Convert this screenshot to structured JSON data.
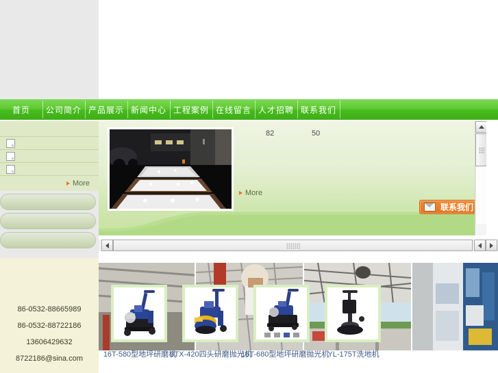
{
  "site": {
    "header": {
      "logo_placeholder": "",
      "banner_placeholder": ""
    },
    "nav": {
      "items": [
        {
          "label": "首页",
          "name": "home"
        },
        {
          "label": "公司简介",
          "name": "about"
        },
        {
          "label": "产品展示",
          "name": "products"
        },
        {
          "label": "新闻中心",
          "name": "news"
        },
        {
          "label": "工程案例",
          "name": "cases"
        },
        {
          "label": "在线留言",
          "name": "message"
        },
        {
          "label": "人才招聘",
          "name": "jobs"
        },
        {
          "label": "联系我们",
          "name": "contact"
        }
      ]
    },
    "sidebar": {
      "rows": [
        {
          "icon": "broken-image-icon",
          "label": ""
        },
        {
          "icon": "broken-image-icon",
          "label": ""
        },
        {
          "icon": "broken-image-icon",
          "label": ""
        }
      ],
      "more_label": "More",
      "buttons": [
        {
          "label": ""
        },
        {
          "label": ""
        },
        {
          "label": ""
        }
      ],
      "contact_lines": [
        "86-0532-88665989",
        "86-0532-88722186",
        "13606429632",
        "8722186@sina.com"
      ]
    },
    "showcase": {
      "hero_image_alt": "polished-stone-floor-showroom",
      "stat_a": "82",
      "stat_b": "50",
      "more_label": "More",
      "contact_button": {
        "label": "联系我们",
        "icon": "envelope-icon",
        "bg_color": "#e4741d"
      }
    },
    "scrollbars": {
      "vertical": {
        "up": "▲",
        "down": "▼"
      },
      "horizontal": {
        "left": "◀",
        "right": "▶"
      }
    },
    "products": [
      {
        "label": "16T-580型地坪研磨机",
        "alt": "blue-floor-grinder-580"
      },
      {
        "label": "3TX-420四头研磨抛光机",
        "alt": "blue-yellow-floor-grinder-420"
      },
      {
        "label": "16T-680型地坪研磨抛光机",
        "alt": "blue-floor-grinder-680"
      },
      {
        "label": "YL-175T洗地机",
        "alt": "black-single-disc-polisher"
      }
    ]
  },
  "colors": {
    "nav_green": "#4dbf22",
    "panel_green": "#cfe6ae",
    "sidebar_green": "#dfe9c8",
    "sidebar_cream": "#f4f2d8",
    "accent_orange": "#e4741d",
    "link_blue": "#3d5a86"
  }
}
